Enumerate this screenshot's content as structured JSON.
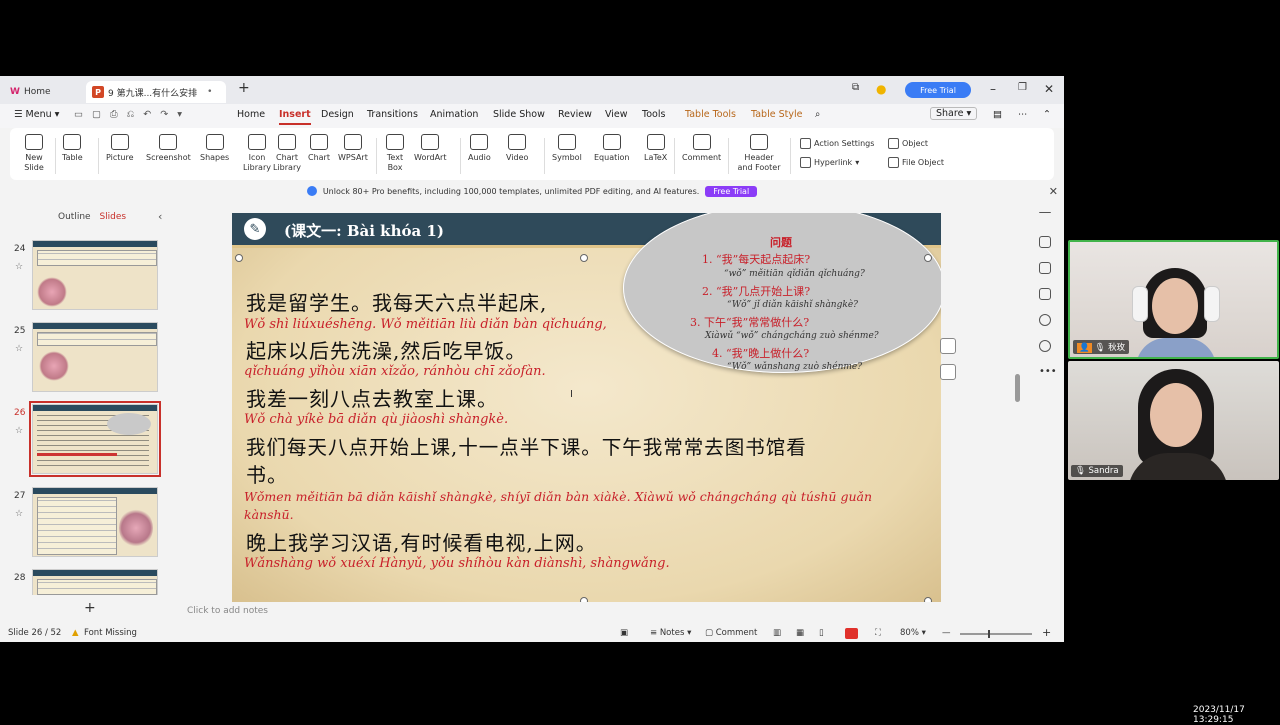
{
  "tabs": {
    "home": "Home",
    "doc": "9 第九课...有什么安排"
  },
  "header": {
    "free_trial": "Free Trial",
    "share": "Share"
  },
  "menu": [
    "Menu",
    "Home",
    "Insert",
    "Design",
    "Transitions",
    "Animation",
    "Slide Show",
    "Review",
    "View",
    "Tools",
    "Table Tools",
    "Table Style"
  ],
  "ribbon": {
    "new_slide": "New Slide",
    "table": "Table",
    "picture": "Picture",
    "screenshot": "Screenshot",
    "shapes": "Shapes",
    "icon_library": "Icon Library",
    "chart_library": "Chart Library",
    "chart": "Chart",
    "wpsart": "WPSArt",
    "text_box": "Text Box",
    "wordart": "WordArt",
    "audio": "Audio",
    "video": "Video",
    "symbol": "Symbol",
    "equation": "Equation",
    "latex": "LaTeX",
    "comment": "Comment",
    "header_footer": "Header and Footer",
    "action_settings": "Action Settings",
    "hyperlink": "Hyperlink",
    "object": "Object",
    "file_object": "File Object"
  },
  "promo": {
    "text": "Unlock 80+ Pro benefits, including 100,000 templates, unlimited PDF editing, and AI features.",
    "button": "Free Trial"
  },
  "left_panel": {
    "outline": "Outline",
    "slides": "Slides",
    "thumbs": [
      "24",
      "25",
      "26",
      "27",
      "28"
    ],
    "active": "26"
  },
  "slide": {
    "title": "(课文一:  Bài khóa 1)",
    "lines": [
      {
        "cn": "我是留学生。我每天六点半起床,",
        "py": "Wǒ shì liúxuéshēng. Wǒ měitiān liù diǎn bàn qǐchuáng,"
      },
      {
        "cn": "起床以后先洗澡,然后吃早饭。",
        "py": "qǐchuáng yǐhòu xiān xǐzǎo, ránhòu chī zǎofàn."
      },
      {
        "cn": "我差一刻八点去教室上课。",
        "py": "Wǒ chà yíkè  bā diǎn qù jiàoshì shàngkè."
      },
      {
        "cn": "我们每天八点开始上课,十一点半下课。下午我常常去图书馆看",
        "cn2": "书。",
        "py": "Wǒmen měitiān bā diǎn kāishǐ shàngkè, shíyī diǎn bàn xiàkè. Xiàwǔ wǒ chángcháng qù túshū guǎn",
        "py2": "kànshū."
      },
      {
        "cn": "晚上我学习汉语,有时候看电视,上网。",
        "py": "Wǎnshàng wǒ xuéxí Hànyǔ, yǒu shíhòu kàn diànshì, shàngwǎng."
      }
    ],
    "questions_title": "问题",
    "questions": [
      {
        "q": "1.  “我”每天起点起床?",
        "py": "“wǒ” měitiān qǐdiǎn qǐchuáng?"
      },
      {
        "q": "2.  “我”几点开始上课?",
        "py": "“Wǒ” jǐ diǎn kāishǐ shàngkè?"
      },
      {
        "q": "3.  下午“我”常常做什么?",
        "py": "Xiàwǔ “wǒ” chángcháng zuò shénme?"
      },
      {
        "q": "4.  “我”晚上做什么?",
        "py": "“Wǒ” wǎnshang zuò shénme?"
      }
    ]
  },
  "notes_placeholder": "Click to add notes",
  "status": {
    "slide": "Slide 26 / 52",
    "font_missing": "Font Missing",
    "notes": "Notes",
    "comment": "Comment",
    "zoom": "80%"
  },
  "video": {
    "p1": "秋玫",
    "p2": "Sandra",
    "timestamp": "2023/11/17 13:29:15"
  }
}
